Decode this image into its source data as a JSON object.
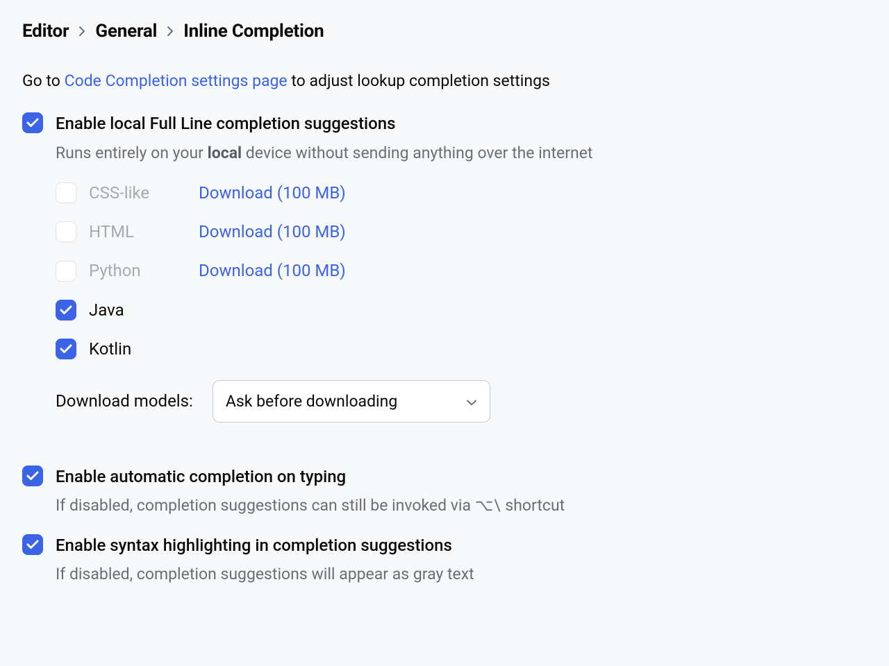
{
  "breadcrumb": {
    "a": "Editor",
    "b": "General",
    "c": "Inline Completion"
  },
  "intro": {
    "pre": "Go to ",
    "link": "Code Completion settings page",
    "post": " to adjust lookup completion settings"
  },
  "fullLine": {
    "label": "Enable local Full Line completion suggestions",
    "desc_pre": "Runs entirely on your ",
    "desc_bold": "local",
    "desc_post": " device without sending anything over the internet"
  },
  "langs": {
    "css": {
      "label": "CSS-like",
      "download": "Download (100 MB)"
    },
    "html": {
      "label": "HTML",
      "download": "Download (100 MB)"
    },
    "python": {
      "label": "Python",
      "download": "Download (100 MB)"
    },
    "java": {
      "label": "Java"
    },
    "kotlin": {
      "label": "Kotlin"
    }
  },
  "models": {
    "label": "Download models:",
    "value": "Ask before downloading"
  },
  "autoTyping": {
    "label": "Enable automatic completion on typing",
    "desc_pre": "If disabled, completion suggestions can still be invoked via ",
    "shortcut": "⌥\\",
    "desc_post": " shortcut"
  },
  "syntaxHl": {
    "label": "Enable syntax highlighting in completion suggestions",
    "desc": "If disabled, completion suggestions will appear as gray text"
  }
}
